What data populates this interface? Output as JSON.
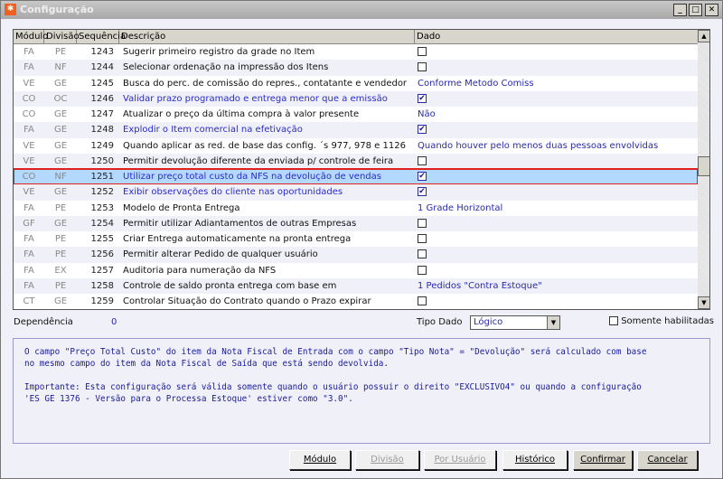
{
  "window": {
    "title": "Configuração"
  },
  "table": {
    "headers": [
      "Módulo",
      "Divisão",
      "Sequência",
      "Descrição",
      "Dado"
    ],
    "rows": [
      {
        "modulo": "FA",
        "divisao": "PE",
        "seq": "1243",
        "descricao": "Sugerir primeiro registro da grade no Item",
        "dado": "",
        "checked": false,
        "type": "check",
        "blue": false
      },
      {
        "modulo": "FA",
        "divisao": "NF",
        "seq": "1244",
        "descricao": "Selecionar ordenação na impressão dos Itens",
        "dado": "",
        "checked": false,
        "type": "check",
        "blue": false
      },
      {
        "modulo": "VE",
        "divisao": "GE",
        "seq": "1245",
        "descricao": "Busca do perc. de comissão do repres., contatante e vendedor",
        "dado": "Conforme Metodo Comiss",
        "type": "text",
        "blue": false
      },
      {
        "modulo": "CO",
        "divisao": "OC",
        "seq": "1246",
        "descricao": "Validar prazo programado e entrega menor que a emissão",
        "dado": "",
        "checked": true,
        "type": "check",
        "blue": true
      },
      {
        "modulo": "CO",
        "divisao": "GE",
        "seq": "1247",
        "descricao": "Atualizar o preço da última compra à valor presente",
        "dado": "Não",
        "type": "text",
        "blue": false
      },
      {
        "modulo": "FA",
        "divisao": "GE",
        "seq": "1248",
        "descricao": "Explodir o Item comercial na efetivação",
        "dado": "",
        "checked": true,
        "type": "check",
        "blue": true
      },
      {
        "modulo": "VE",
        "divisao": "GE",
        "seq": "1249",
        "descricao": "Quando aplicar as red. de base das config. ´s 977, 978 e 1126",
        "dado": "Quando houver pelo menos duas pessoas envolvidas",
        "type": "text",
        "blue": false
      },
      {
        "modulo": "VE",
        "divisao": "GE",
        "seq": "1250",
        "descricao": "Permitir devolução diferente da enviada p/ controle de feira",
        "dado": "",
        "checked": false,
        "type": "check",
        "blue": false
      },
      {
        "modulo": "CO",
        "divisao": "NF",
        "seq": "1251",
        "descricao": "Utilizar preço total custo da NFS na devolução de vendas",
        "dado": "",
        "checked": true,
        "type": "check",
        "blue": true,
        "selected": true
      },
      {
        "modulo": "VE",
        "divisao": "GE",
        "seq": "1252",
        "descricao": "Exibir observações do cliente nas oportunidades",
        "dado": "",
        "checked": true,
        "type": "check",
        "blue": true
      },
      {
        "modulo": "FA",
        "divisao": "PE",
        "seq": "1253",
        "descricao": "Modelo de Pronta Entrega",
        "dado": "1 Grade Horizontal",
        "type": "text",
        "blue": false
      },
      {
        "modulo": "GF",
        "divisao": "GE",
        "seq": "1254",
        "descricao": "Permitir utilizar Adiantamentos de outras Empresas",
        "dado": "",
        "checked": false,
        "type": "check",
        "blue": false
      },
      {
        "modulo": "FA",
        "divisao": "PE",
        "seq": "1255",
        "descricao": "Criar Entrega automaticamente na pronta entrega",
        "dado": "",
        "checked": false,
        "type": "check",
        "blue": false
      },
      {
        "modulo": "FA",
        "divisao": "PE",
        "seq": "1256",
        "descricao": "Permitir alterar Pedido de qualquer usuário",
        "dado": "",
        "checked": false,
        "type": "check",
        "blue": false
      },
      {
        "modulo": "FA",
        "divisao": "EX",
        "seq": "1257",
        "descricao": "Auditoria para numeração da NFS",
        "dado": "",
        "checked": false,
        "type": "check",
        "blue": false
      },
      {
        "modulo": "FA",
        "divisao": "PE",
        "seq": "1258",
        "descricao": "Controle de saldo pronta entrega com base em",
        "dado": "1 Pedidos \"Contra Estoque\"",
        "type": "text",
        "blue": false
      },
      {
        "modulo": "CT",
        "divisao": "GE",
        "seq": "1259",
        "descricao": "Controlar Situação do Contrato quando o Prazo expirar",
        "dado": "",
        "checked": false,
        "type": "check",
        "blue": false
      }
    ]
  },
  "footer": {
    "dependencia_label": "Dependência",
    "dependencia_value": "0",
    "tipo_dado_label": "Tipo Dado",
    "tipo_dado_value": "Lógico",
    "somente_label": "Somente habilitadas",
    "description": "O campo \"Preço Total Custo\" do item da Nota Fiscal de Entrada com o campo \"Tipo Nota\" = \"Devolução\" será calculado com base\nno mesmo campo do item da Nota Fiscal de Saída que está sendo devolvida.\n\nImportante: Esta configuração será válida somente quando o usuário possuir o direito \"EXCLUSIVO4\" ou quando a configuração\n'ES GE 1376 - Versão para o Processa Estoque' estiver como \"3.0\".",
    "buttons": {
      "modulo": "Módulo",
      "divisao": "Divisão",
      "por_usuario": "Por Usuário",
      "historico": "Histórico",
      "confirmar": "Confirmar",
      "cancelar": "Cancelar"
    }
  }
}
